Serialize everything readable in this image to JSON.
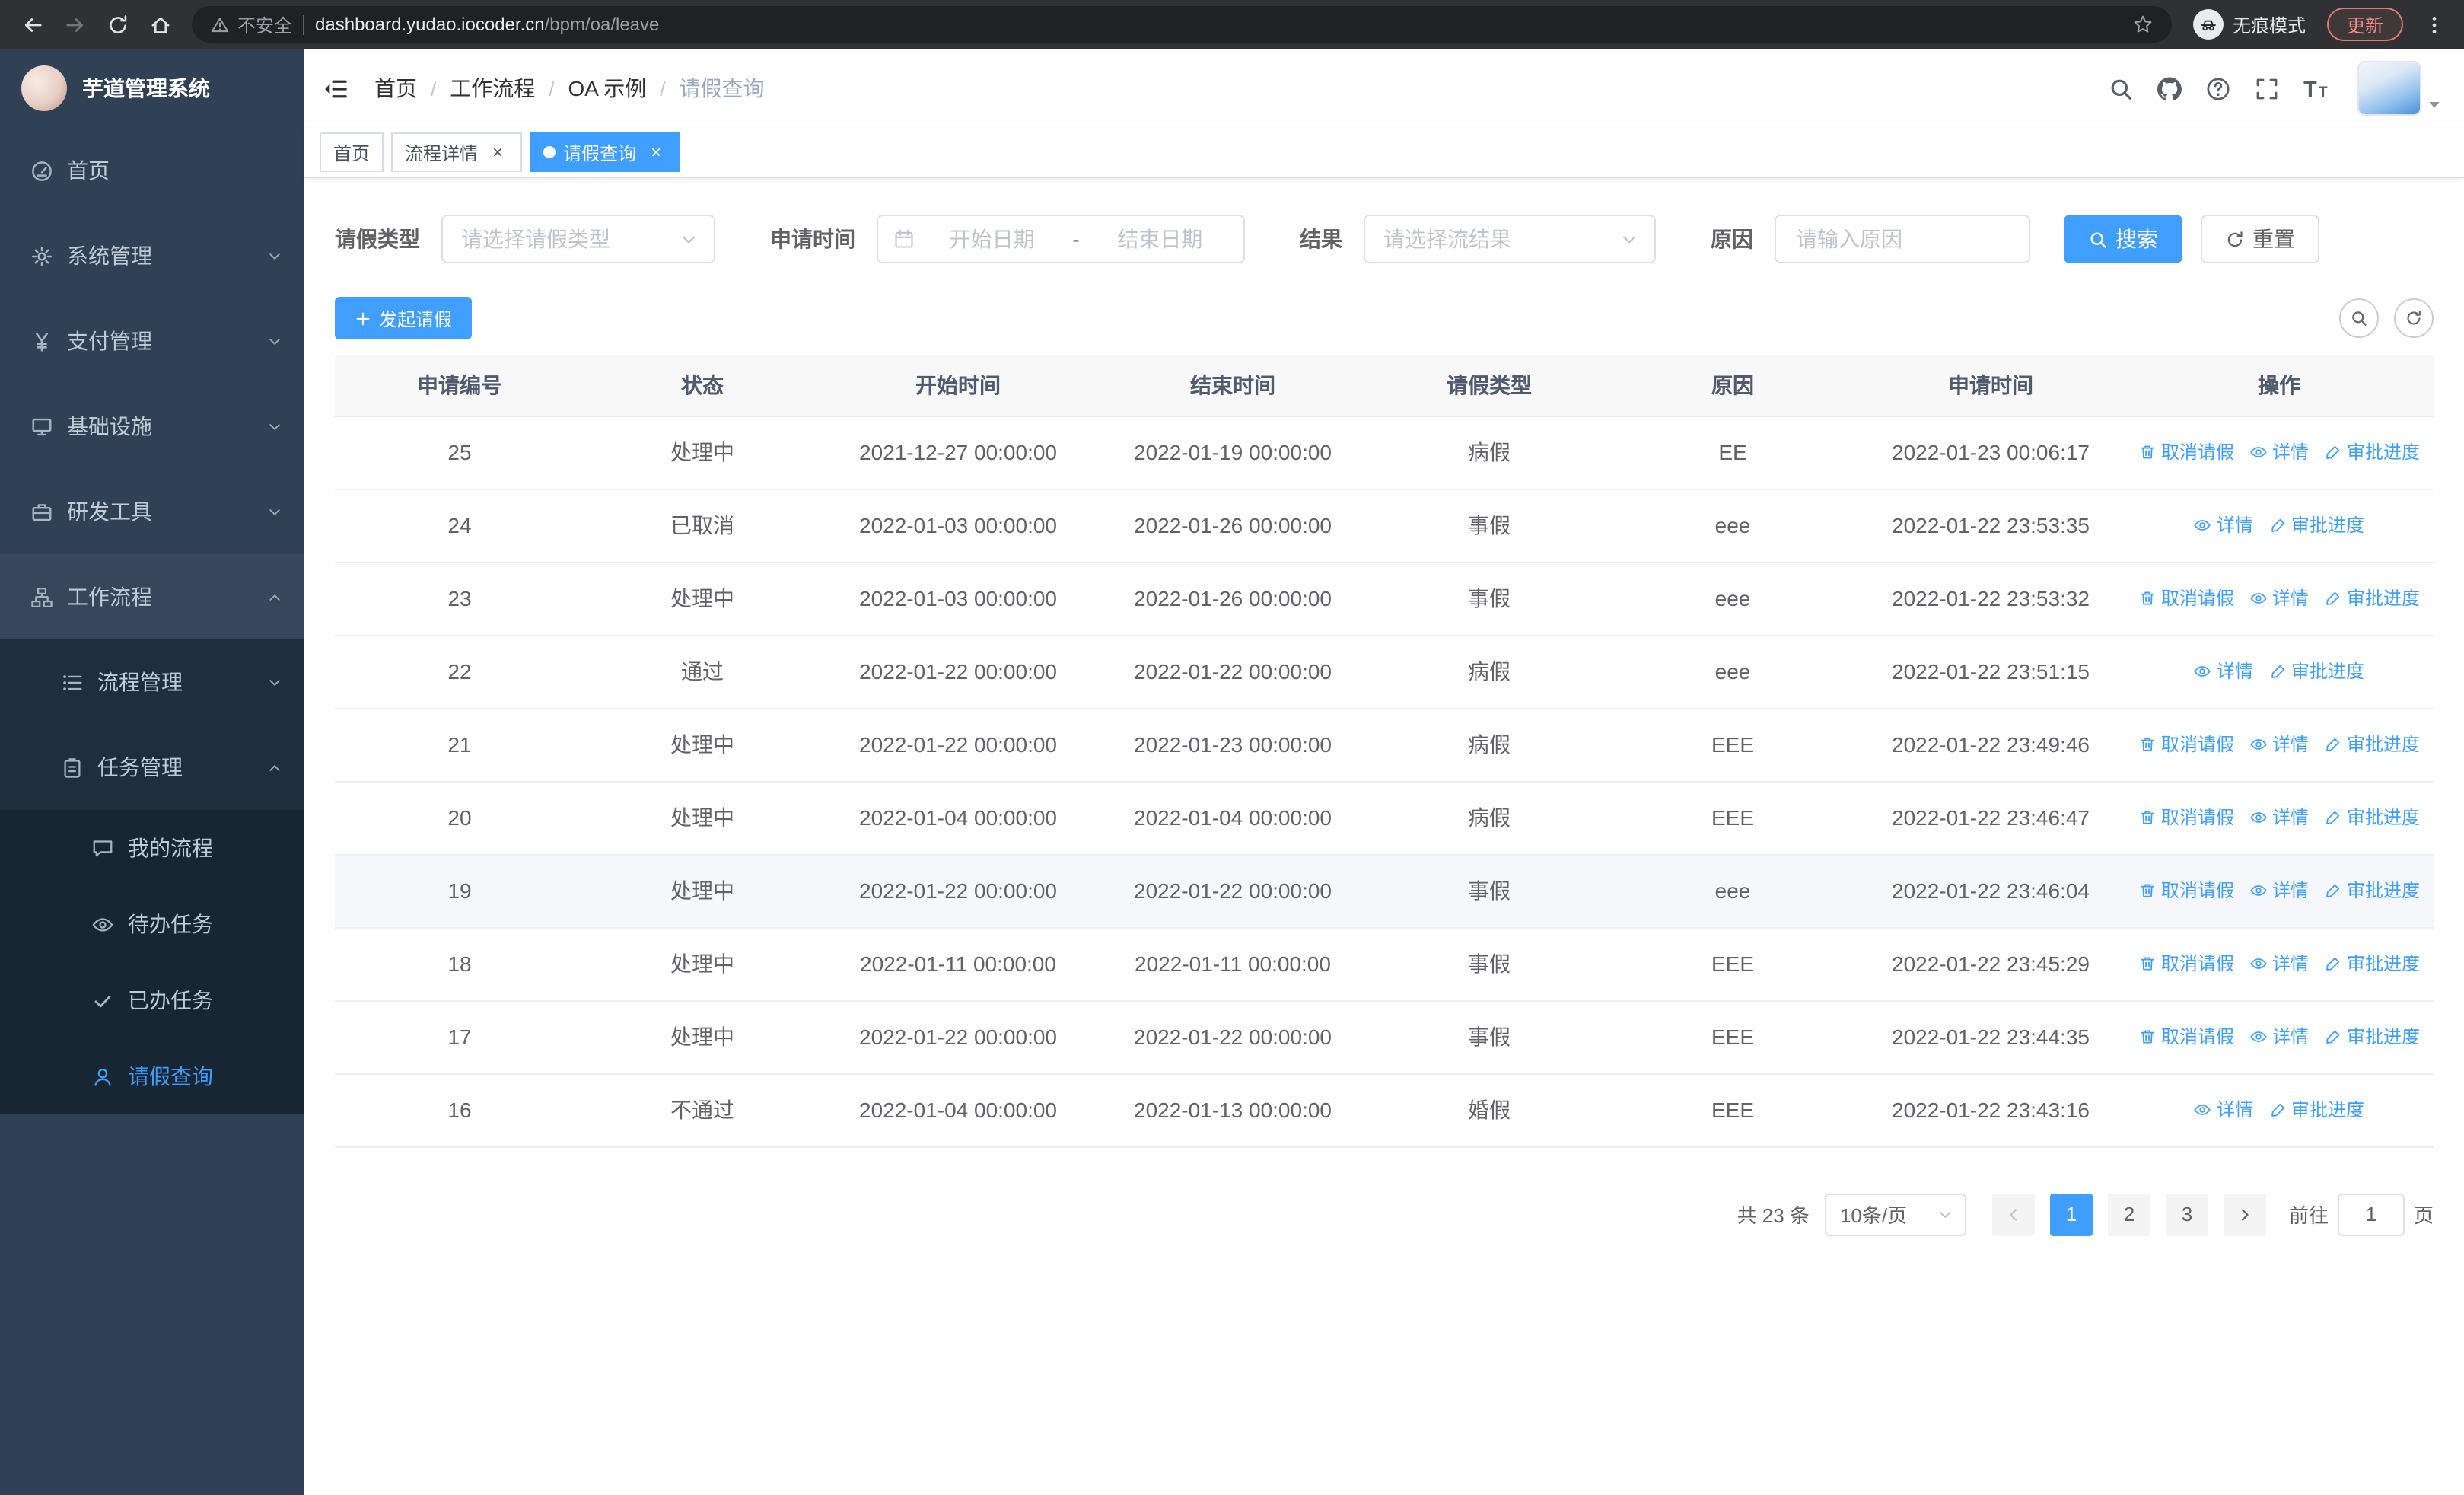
{
  "colors": {
    "primary": "#409eff",
    "sidebar_bg": "#304156",
    "sidebar_submenu_bg": "#1f2d3d",
    "table_header_bg": "#f8f8f9"
  },
  "browser": {
    "security_label": "不安全",
    "url_host": "dashboard.yudao.iocoder.cn",
    "url_path": "/bpm/oa/leave",
    "incognito_label": "无痕模式",
    "update_label": "更新"
  },
  "sidebar": {
    "logo_title": "芋道管理系统",
    "menu": [
      {
        "key": "home",
        "label": "首页",
        "icon": "dashboard-icon",
        "level": 1
      },
      {
        "key": "system",
        "label": "系统管理",
        "icon": "gear-icon",
        "level": 1,
        "arrow": "down"
      },
      {
        "key": "payment",
        "label": "支付管理",
        "icon": "yen-icon",
        "level": 1,
        "arrow": "down"
      },
      {
        "key": "infrastructure",
        "label": "基础设施",
        "icon": "infrastructure-icon",
        "level": 1,
        "arrow": "down"
      },
      {
        "key": "dev-tools",
        "label": "研发工具",
        "icon": "tools-icon",
        "level": 1,
        "arrow": "down"
      },
      {
        "key": "workflow",
        "label": "工作流程",
        "icon": "workflow-icon",
        "level": 1,
        "arrow": "up",
        "open": true
      },
      {
        "key": "process-manage",
        "label": "流程管理",
        "icon": "process-icon",
        "level": 2,
        "arrow": "down"
      },
      {
        "key": "task-manage",
        "label": "任务管理",
        "icon": "task-icon",
        "level": 2,
        "arrow": "up",
        "open": true
      },
      {
        "key": "my-process",
        "label": "我的流程",
        "icon": "chat-icon",
        "level": 3
      },
      {
        "key": "todo-task",
        "label": "待办任务",
        "icon": "eye-icon",
        "level": 3
      },
      {
        "key": "done-task",
        "label": "已办任务",
        "icon": "check-icon",
        "level": 3
      },
      {
        "key": "leave-query",
        "label": "请假查询",
        "icon": "user-icon",
        "level": 3,
        "active": true
      }
    ]
  },
  "navbar": {
    "separator": "/",
    "breadcrumb": [
      {
        "label": "首页"
      },
      {
        "label": "工作流程"
      },
      {
        "label": "OA 示例"
      },
      {
        "label": "请假查询",
        "current": true
      }
    ],
    "tools": [
      "search-icon",
      "github-icon",
      "help-icon",
      "fullscreen-icon",
      "font-size-icon"
    ]
  },
  "tabs": [
    {
      "key": "home",
      "label": "首页"
    },
    {
      "key": "process-detail",
      "label": "流程详情",
      "closable": true
    },
    {
      "key": "leave-query",
      "label": "请假查询",
      "closable": true,
      "active": true
    }
  ],
  "filters": {
    "leave_type_label": "请假类型",
    "leave_type_placeholder": "请选择请假类型",
    "apply_time_label": "申请时间",
    "start_date_placeholder": "开始日期",
    "range_separator": "-",
    "end_date_placeholder": "结束日期",
    "result_label": "结果",
    "result_placeholder": "请选择流结果",
    "reason_label": "原因",
    "reason_placeholder": "请输入原因",
    "search_label": "搜索",
    "reset_label": "重置"
  },
  "toolbar": {
    "create_label": "发起请假"
  },
  "table": {
    "columns": [
      "申请编号",
      "状态",
      "开始时间",
      "结束时间",
      "请假类型",
      "原因",
      "申请时间",
      "操作"
    ],
    "action_defs": {
      "cancel": {
        "label": "取消请假",
        "icon": "trash-icon",
        "name": "cancel-leave-link"
      },
      "detail": {
        "label": "详情",
        "icon": "eye-icon",
        "name": "detail-link"
      },
      "progress": {
        "label": "审批进度",
        "icon": "edit-icon",
        "name": "approval-progress-link"
      }
    },
    "rows": [
      {
        "id": "25",
        "status": "处理中",
        "start_time": "2021-12-27 00:00:00",
        "end_time": "2022-01-19 00:00:00",
        "leave_type": "病假",
        "reason": "EE",
        "apply_time": "2022-01-23 00:06:17",
        "actions": [
          "cancel",
          "detail",
          "progress"
        ]
      },
      {
        "id": "24",
        "status": "已取消",
        "start_time": "2022-01-03 00:00:00",
        "end_time": "2022-01-26 00:00:00",
        "leave_type": "事假",
        "reason": "eee",
        "apply_time": "2022-01-22 23:53:35",
        "actions": [
          "detail",
          "progress"
        ]
      },
      {
        "id": "23",
        "status": "处理中",
        "start_time": "2022-01-03 00:00:00",
        "end_time": "2022-01-26 00:00:00",
        "leave_type": "事假",
        "reason": "eee",
        "apply_time": "2022-01-22 23:53:32",
        "actions": [
          "cancel",
          "detail",
          "progress"
        ]
      },
      {
        "id": "22",
        "status": "通过",
        "start_time": "2022-01-22 00:00:00",
        "end_time": "2022-01-22 00:00:00",
        "leave_type": "病假",
        "reason": "eee",
        "apply_time": "2022-01-22 23:51:15",
        "actions": [
          "detail",
          "progress"
        ]
      },
      {
        "id": "21",
        "status": "处理中",
        "start_time": "2022-01-22 00:00:00",
        "end_time": "2022-01-23 00:00:00",
        "leave_type": "病假",
        "reason": "EEE",
        "apply_time": "2022-01-22 23:49:46",
        "actions": [
          "cancel",
          "detail",
          "progress"
        ]
      },
      {
        "id": "20",
        "status": "处理中",
        "start_time": "2022-01-04 00:00:00",
        "end_time": "2022-01-04 00:00:00",
        "leave_type": "病假",
        "reason": "EEE",
        "apply_time": "2022-01-22 23:46:47",
        "actions": [
          "cancel",
          "detail",
          "progress"
        ]
      },
      {
        "id": "19",
        "status": "处理中",
        "start_time": "2022-01-22 00:00:00",
        "end_time": "2022-01-22 00:00:00",
        "leave_type": "事假",
        "reason": "eee",
        "apply_time": "2022-01-22 23:46:04",
        "actions": [
          "cancel",
          "detail",
          "progress"
        ],
        "highlighted": true
      },
      {
        "id": "18",
        "status": "处理中",
        "start_time": "2022-01-11 00:00:00",
        "end_time": "2022-01-11 00:00:00",
        "leave_type": "事假",
        "reason": "EEE",
        "apply_time": "2022-01-22 23:45:29",
        "actions": [
          "cancel",
          "detail",
          "progress"
        ]
      },
      {
        "id": "17",
        "status": "处理中",
        "start_time": "2022-01-22 00:00:00",
        "end_time": "2022-01-22 00:00:00",
        "leave_type": "事假",
        "reason": "EEE",
        "apply_time": "2022-01-22 23:44:35",
        "actions": [
          "cancel",
          "detail",
          "progress"
        ]
      },
      {
        "id": "16",
        "status": "不通过",
        "start_time": "2022-01-04 00:00:00",
        "end_time": "2022-01-13 00:00:00",
        "leave_type": "婚假",
        "reason": "EEE",
        "apply_time": "2022-01-22 23:43:16",
        "actions": [
          "detail",
          "progress"
        ]
      }
    ]
  },
  "pagination": {
    "total_label": "共 23 条",
    "page_size_label": "10条/页",
    "pages": [
      {
        "label": "1",
        "active": true
      },
      {
        "label": "2"
      },
      {
        "label": "3"
      }
    ],
    "goto_label": "前往",
    "goto_value": "1",
    "goto_unit": "页"
  }
}
